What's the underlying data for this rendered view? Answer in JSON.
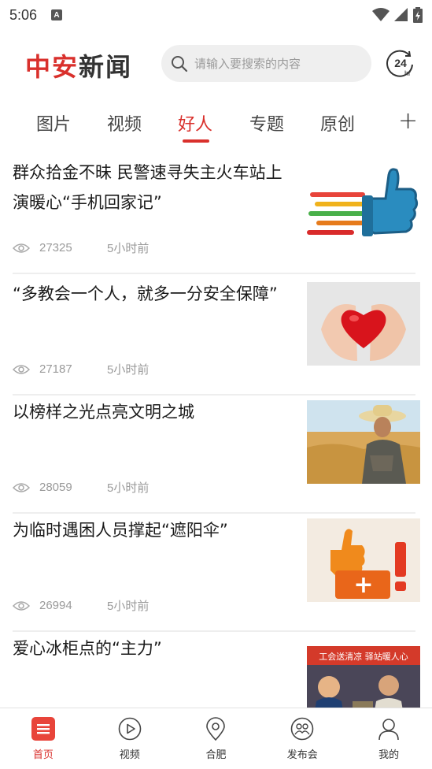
{
  "status_bar": {
    "time": "5:06",
    "notification_letter": "A"
  },
  "header": {
    "logo_part1": "中安",
    "logo_part2": "新闻",
    "search_placeholder": "请输入要搜索的内容",
    "hours_icon_number": "24",
    "hours_icon_unit": "hr"
  },
  "tabs": [
    {
      "label": "图片",
      "active": false
    },
    {
      "label": "视频",
      "active": false
    },
    {
      "label": "好人",
      "active": true
    },
    {
      "label": "专题",
      "active": false
    },
    {
      "label": "原创",
      "active": false
    }
  ],
  "tab_more_label": "+",
  "news": [
    {
      "title": "群众拾金不昧 民警速寻失主火车站上演暖心“手机回家记”",
      "views": "27325",
      "time": "5小时前",
      "image": "thumbs-up-icon"
    },
    {
      "title": "“多教会一个人，就多一分安全保障”",
      "views": "27187",
      "time": "5小时前",
      "image": "heart-hands-icon"
    },
    {
      "title": "以榜样之光点亮文明之城",
      "views": "28059",
      "time": "5小时前",
      "image": "farmer-wheat-photo"
    },
    {
      "title": "为临时遇困人员撑起“遮阳伞”",
      "views": "26994",
      "time": "5小时前",
      "image": "praise-sign-icon"
    },
    {
      "title": "爱心冰柜点的“主力”",
      "views": "",
      "time": "",
      "image": "volunteers-photo"
    }
  ],
  "news_banner_text": "工会送清凉 驿站暖人心",
  "bottom_nav": [
    {
      "label": "首页",
      "icon": "home-list-icon",
      "active": true
    },
    {
      "label": "视频",
      "icon": "play-icon",
      "active": false
    },
    {
      "label": "合肥",
      "icon": "location-pin-icon",
      "active": false
    },
    {
      "label": "发布会",
      "icon": "people-icon",
      "active": false
    },
    {
      "label": "我的",
      "icon": "user-icon",
      "active": false
    }
  ],
  "colors": {
    "accent": "#d9302c",
    "text": "#1a1a1a",
    "meta": "#9a9a9a",
    "search_bg": "#efefef"
  }
}
